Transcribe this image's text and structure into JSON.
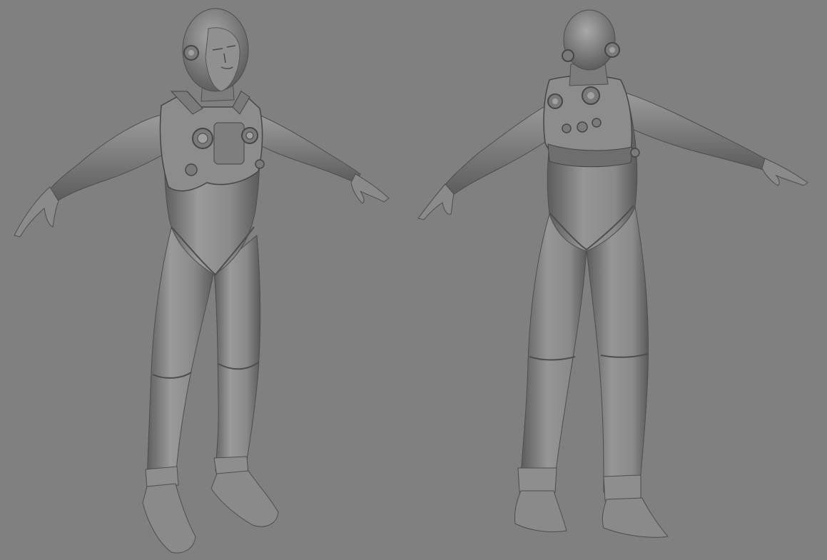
{
  "viewport": {
    "background_color": "#808080",
    "model_color": "#8c8c8c",
    "shadow_color": "#4a4a4a",
    "highlight_color": "#b4b4b4"
  },
  "models": [
    {
      "view": "front-three-quarter",
      "description_icon": "character-front-view"
    },
    {
      "view": "back-three-quarter",
      "description_icon": "character-back-view"
    }
  ]
}
